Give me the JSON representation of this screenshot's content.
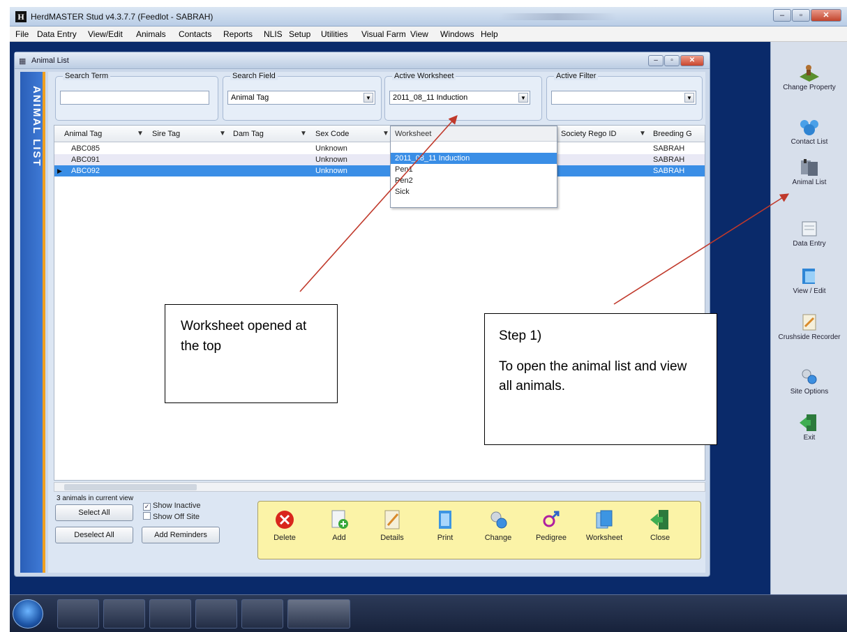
{
  "app": {
    "title": "HerdMASTER Stud  v4.3.7.7 (Feedlot - SABRAH)",
    "logo_text": "H"
  },
  "menu": [
    "File",
    "Data Entry",
    "View/Edit",
    "Animals",
    "Contacts",
    "Reports",
    "NLIS",
    "Setup",
    "Utilities",
    "Visual Farm",
    "View",
    "Windows",
    "Help"
  ],
  "right_toolbar": [
    {
      "label": "Change Property",
      "icon": "change-property-icon"
    },
    {
      "label": "Contact List",
      "icon": "contact-list-icon"
    },
    {
      "label": "Animal List",
      "icon": "animal-list-icon"
    },
    {
      "label": "Data Entry",
      "icon": "data-entry-icon"
    },
    {
      "label": "View / Edit",
      "icon": "view-edit-icon"
    },
    {
      "label": "Crushside Recorder",
      "icon": "crushside-recorder-icon"
    },
    {
      "label": "Site Options",
      "icon": "site-options-icon"
    },
    {
      "label": "Exit",
      "icon": "exit-icon"
    }
  ],
  "child_window": {
    "title": "Animal List",
    "side_tab": "ANIMAL LIST"
  },
  "filters": {
    "search_term": {
      "label": "Search Term",
      "value": ""
    },
    "search_field": {
      "label": "Search Field",
      "value": "Animal Tag"
    },
    "active_worksheet": {
      "label": "Active Worksheet",
      "value": "2011_08_11 Induction"
    },
    "active_filter": {
      "label": "Active Filter",
      "value": ""
    }
  },
  "grid": {
    "columns": [
      "Animal Tag",
      "Sire Tag",
      "Dam Tag",
      "Sex Code",
      "Society Rego ID",
      "Breeding G"
    ],
    "rows": [
      {
        "animal_tag": "ABC085",
        "sex_code": "Unknown",
        "breeding": "SABRAH"
      },
      {
        "animal_tag": "ABC091",
        "sex_code": "Unknown",
        "breeding": "SABRAH"
      },
      {
        "animal_tag": "ABC092",
        "sex_code": "Unknown",
        "breeding": "SABRAH"
      }
    ],
    "selected_row": 2
  },
  "worksheet_dropdown": {
    "header": "Worksheet",
    "options": [
      "",
      "2011_08_11 Induction",
      "Pen1",
      "Pen2",
      "Sick"
    ],
    "selected": "2011_08_11 Induction"
  },
  "footer": {
    "count_text": "3 animals in current view",
    "select_all": "Select All",
    "deselect_all": "Deselect All",
    "add_reminders": "Add Reminders",
    "show_inactive": {
      "label": "Show Inactive",
      "checked": true
    },
    "show_off_site": {
      "label": "Show Off Site",
      "checked": false
    }
  },
  "bottom_toolbar": [
    "Delete",
    "Add",
    "Details",
    "Print",
    "Change",
    "Pedigree",
    "Worksheet",
    "Close"
  ],
  "annotations": {
    "left": [
      "Worksheet opened at the top"
    ],
    "right": [
      "Step 1)",
      "To open the animal list and view all animals."
    ]
  },
  "colors": {
    "selection": "#3a8ee6",
    "side_tab": "#2a5fb8",
    "accent": "#f0a020",
    "toolbar_bg": "#fbf3a7",
    "arrow": "#c0392b"
  }
}
